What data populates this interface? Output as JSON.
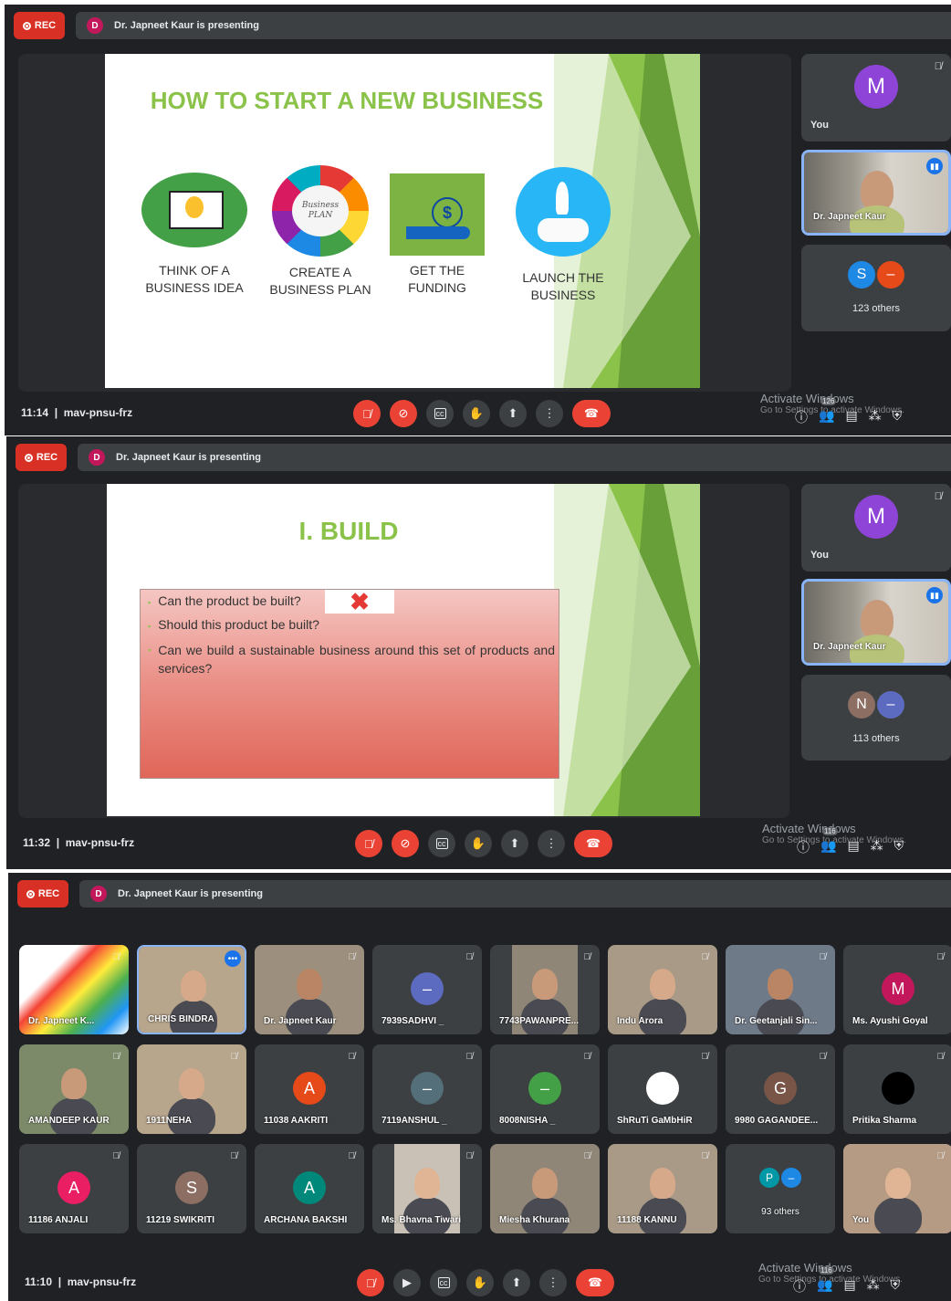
{
  "panels": [
    {
      "rec_label": "REC",
      "presenter_initial": "D",
      "presenting_text": "Dr. Japneet Kaur is presenting",
      "slide": {
        "title": "HOW TO START A NEW BUSINESS",
        "steps": [
          {
            "line1": "THINK OF A",
            "line2": "BUSINESS IDEA"
          },
          {
            "line1": "CREATE A",
            "line2": "BUSINESS PLAN"
          },
          {
            "line1": "GET THE",
            "line2": "FUNDING"
          },
          {
            "line1": "LAUNCH THE",
            "line2": "BUSINESS"
          }
        ],
        "plan_graphic_text": "Business PLAN"
      },
      "you_initial": "M",
      "you_label": "You",
      "speaker_name": "Dr. Japneet Kaur",
      "others_initials": [
        "S",
        "–"
      ],
      "others_label": "123 others",
      "time": "11:14",
      "meeting_code": "mav-pnsu-frz",
      "participants_count": "126",
      "activate_title": "Activate Windows",
      "activate_sub": "Go to Settings to activate Windows."
    },
    {
      "rec_label": "REC",
      "presenter_initial": "D",
      "presenting_text": "Dr. Japneet Kaur is presenting",
      "slide": {
        "title": "I. BUILD",
        "bullets": [
          "Can the product be built?",
          "Should this product be built?",
          "Can we build a sustainable business around this set of products and services?"
        ]
      },
      "you_initial": "M",
      "you_label": "You",
      "speaker_name": "Dr. Japneet Kaur",
      "others_initials": [
        "N",
        "–"
      ],
      "others_label": "113 others",
      "time": "11:32",
      "meeting_code": "mav-pnsu-frz",
      "participants_count": "116",
      "activate_title": "Activate Windows",
      "activate_sub": "Go to Settings to activate Windows."
    },
    {
      "rec_label": "REC",
      "presenter_initial": "D",
      "presenting_text": "Dr. Japneet Kaur is presenting",
      "time": "11:10",
      "meeting_code": "mav-pnsu-frz",
      "participants_count": "116",
      "activate_title": "Activate Windows",
      "activate_sub": "Go to Settings to activate Windows.",
      "grid": [
        {
          "name": "Dr. Japneet K...",
          "kind": "screen"
        },
        {
          "name": "CHRIS BINDRA",
          "kind": "photo",
          "active": true
        },
        {
          "name": "Dr. Japneet Kaur",
          "kind": "photo"
        },
        {
          "name": "7939SADHVI _",
          "kind": "avatar",
          "initial": "–",
          "color": "#5c6bc0"
        },
        {
          "name": "7743PAWANPRE...",
          "kind": "photo"
        },
        {
          "name": "Indu Arora",
          "kind": "photo"
        },
        {
          "name": "Dr. Geetanjali Sin...",
          "kind": "photo"
        },
        {
          "name": "Ms. Ayushi Goyal",
          "kind": "avatar",
          "initial": "M",
          "color": "#c2185b"
        },
        {
          "name": "AMANDEEP KAUR",
          "kind": "photo"
        },
        {
          "name": "1911NEHA",
          "kind": "photo"
        },
        {
          "name": "11038 AAKRITI",
          "kind": "avatar",
          "initial": "A",
          "color": "#e64a19"
        },
        {
          "name": "7119ANSHUL _",
          "kind": "avatar",
          "initial": "–",
          "color": "#546e7a"
        },
        {
          "name": "8008NISHA _",
          "kind": "avatar",
          "initial": "–",
          "color": "#43a047"
        },
        {
          "name": "ShRuTi GaMbHiR",
          "kind": "avatar",
          "initial": "",
          "color": "#ffffff"
        },
        {
          "name": "9980 GAGANDEE...",
          "kind": "avatar",
          "initial": "G",
          "color": "#795548"
        },
        {
          "name": "Pritika Sharma",
          "kind": "avatar",
          "initial": "",
          "color": "#000000"
        },
        {
          "name": "11186 ANJALI",
          "kind": "avatar",
          "initial": "A",
          "color": "#e91e63"
        },
        {
          "name": "11219 SWIKRITI",
          "kind": "avatar",
          "initial": "S",
          "color": "#8d6e63"
        },
        {
          "name": "ARCHANA BAKSHI",
          "kind": "avatar",
          "initial": "A",
          "color": "#00897b"
        },
        {
          "name": "Ms. Bhavna Tiwari",
          "kind": "photo"
        },
        {
          "name": "Miesha Khurana",
          "kind": "photo"
        },
        {
          "name": "11188 KANNU",
          "kind": "photo"
        },
        {
          "name": "93 others",
          "kind": "others",
          "initials": [
            "P",
            "–"
          ]
        },
        {
          "name": "You",
          "kind": "photo"
        }
      ]
    }
  ]
}
